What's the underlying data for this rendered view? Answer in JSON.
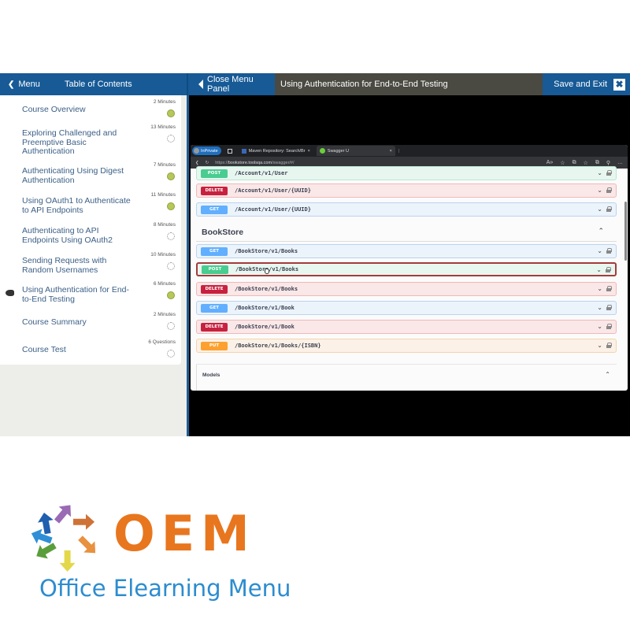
{
  "topbar": {
    "menu_label": "Menu",
    "toc_label": "Table of Contents",
    "close_panel_label": "Close Menu Panel",
    "lesson_title": "Using Authentication for End-to-End Testing",
    "save_exit_label": "Save and Exit",
    "close_icon_glyph": "✖"
  },
  "toc": {
    "items": [
      {
        "title": "Course Overview",
        "duration": "2 Minutes",
        "status": "complete",
        "current": false
      },
      {
        "title": "Exploring Challenged and Preemptive Basic Authentication",
        "duration": "13 Minutes",
        "status": "incomplete",
        "current": false
      },
      {
        "title": "Authenticating Using Digest Authentication",
        "duration": "7 Minutes",
        "status": "complete",
        "current": false
      },
      {
        "title": "Using OAuth1 to Authenticate to API Endpoints",
        "duration": "11 Minutes",
        "status": "complete",
        "current": false
      },
      {
        "title": "Authenticating to API Endpoints Using OAuth2",
        "duration": "8 Minutes",
        "status": "incomplete",
        "current": false
      },
      {
        "title": "Sending Requests with Random Usernames",
        "duration": "10 Minutes",
        "status": "incomplete",
        "current": false
      },
      {
        "title": "Using Authentication for End-to-End Testing",
        "duration": "6 Minutes",
        "status": "complete",
        "current": true
      },
      {
        "title": "Course Summary",
        "duration": "2 Minutes",
        "status": "incomplete",
        "current": false
      },
      {
        "title": "Course Test",
        "duration": "6 Questions",
        "status": "incomplete",
        "current": false
      }
    ]
  },
  "browser": {
    "profile_label": "InPrivate",
    "tabs": [
      {
        "label": "Maven Repository: Search/Br",
        "close": "×"
      },
      {
        "label": "Swagger U",
        "close": "×"
      }
    ],
    "url_prefix": "https://",
    "url_host": "bookstore.toolsqa.com",
    "url_path": "/swagger/#/",
    "toolbar_icons": [
      "A»",
      "☆",
      "⧉",
      "☆",
      "⧉",
      "⚲",
      "…"
    ]
  },
  "swagger": {
    "section_title": "BookStore",
    "operations_top": [
      {
        "method": "POST",
        "path": "/Account/v1/User",
        "type": "post"
      },
      {
        "method": "DELETE",
        "path": "/Account/v1/User/{UUID}",
        "type": "delete"
      },
      {
        "method": "GET",
        "path": "/Account/v1/User/{UUID}",
        "type": "get"
      }
    ],
    "operations_bookstore": [
      {
        "method": "GET",
        "path": "/BookStore/v1/Books",
        "type": "get",
        "selected": false
      },
      {
        "method": "POST",
        "path": "/BookStore/v1/Books",
        "type": "post",
        "selected": true
      },
      {
        "method": "DELETE",
        "path": "/BookStore/v1/Books",
        "type": "delete",
        "selected": false
      },
      {
        "method": "GET",
        "path": "/BookStore/v1/Book",
        "type": "get",
        "selected": false
      },
      {
        "method": "DELETE",
        "path": "/BookStore/v1/Book",
        "type": "delete",
        "selected": false
      },
      {
        "method": "PUT",
        "path": "/BookStore/v1/Books/{ISBN}",
        "type": "put",
        "selected": false
      }
    ],
    "models_label": "Models"
  },
  "logo": {
    "acronym": "OEM",
    "name": "Office Elearning Menu",
    "colors": {
      "acronym": "#e8761e",
      "name": "#2d8ccf",
      "arrows": [
        "#1f5fae",
        "#9a6ab4",
        "#cf7236",
        "#e8913f",
        "#e3d84a",
        "#5a9e3c",
        "#2f8fd6"
      ]
    }
  },
  "colors": {
    "brand_blue": "#175a96",
    "title_bar": "#4a4a42",
    "complete": "#b6c85a"
  }
}
